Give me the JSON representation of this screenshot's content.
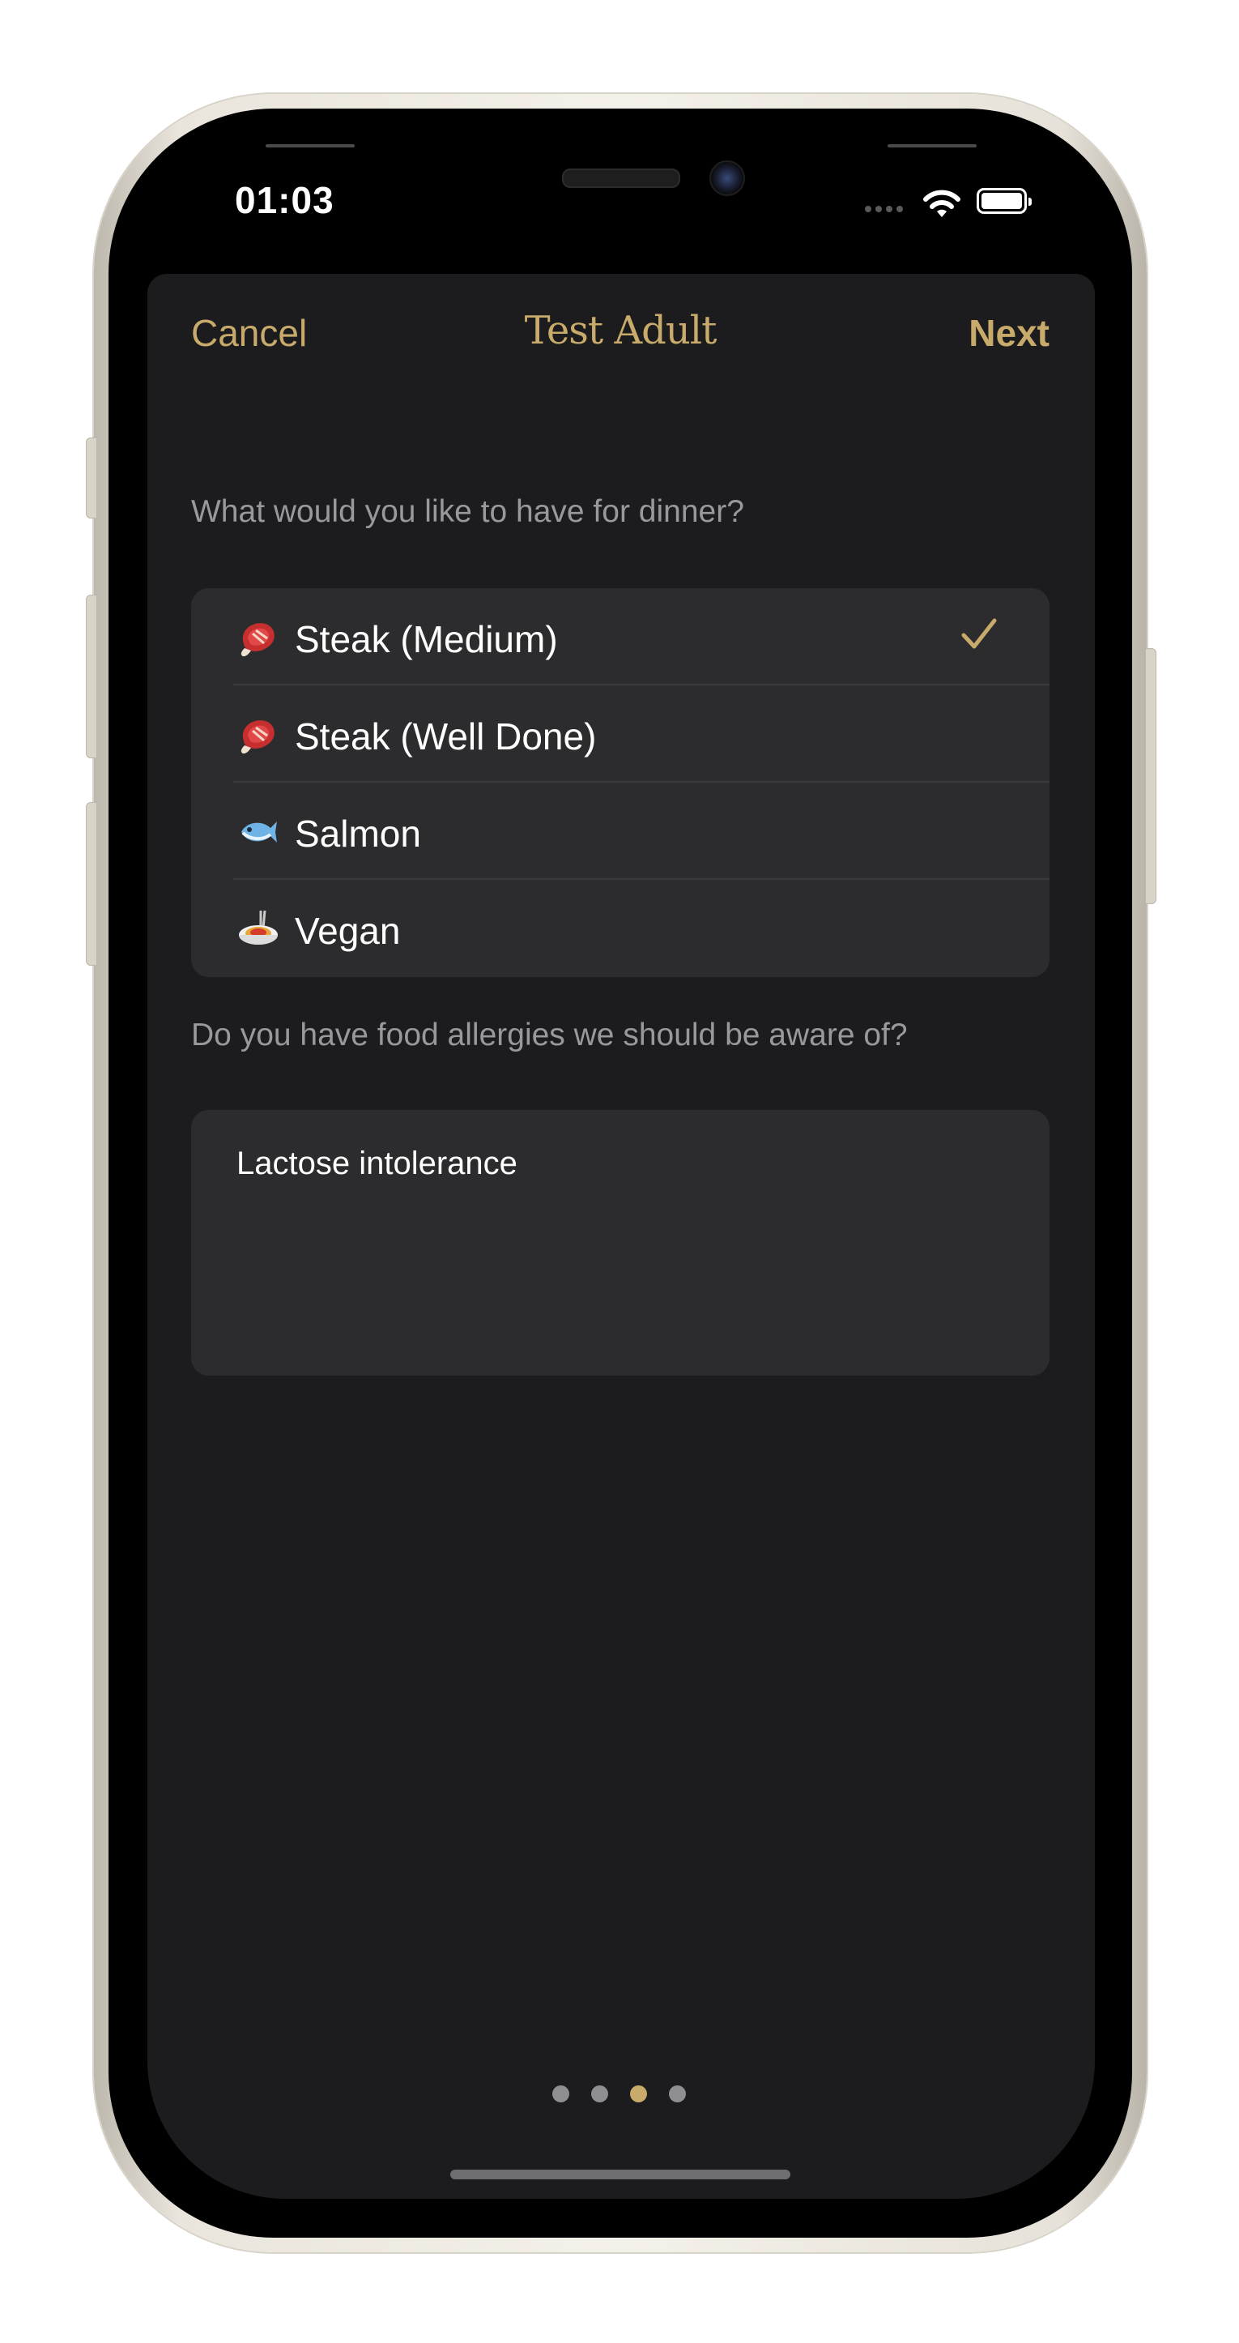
{
  "status_bar": {
    "time": "01:03"
  },
  "nav": {
    "cancel_label": "Cancel",
    "title": "Test Adult",
    "next_label": "Next"
  },
  "dinner": {
    "question": "What would you like to have for dinner?",
    "options": [
      {
        "label": "Steak (Medium)",
        "icon": "meat-icon",
        "selected": true
      },
      {
        "label": "Steak (Well Done)",
        "icon": "meat-icon",
        "selected": false
      },
      {
        "label": "Salmon",
        "icon": "fish-icon",
        "selected": false
      },
      {
        "label": "Vegan",
        "icon": "spaghetti-icon",
        "selected": false
      }
    ]
  },
  "allergies": {
    "question": "Do you have food allergies we should be aware of?",
    "value": "Lactose intolerance"
  },
  "pager": {
    "total": 4,
    "current": 3
  },
  "colors": {
    "accent": "#c8aa6b",
    "sheet_background": "#1c1c1e",
    "cell_background": "#2c2c2e",
    "secondary_text": "#98989e"
  }
}
